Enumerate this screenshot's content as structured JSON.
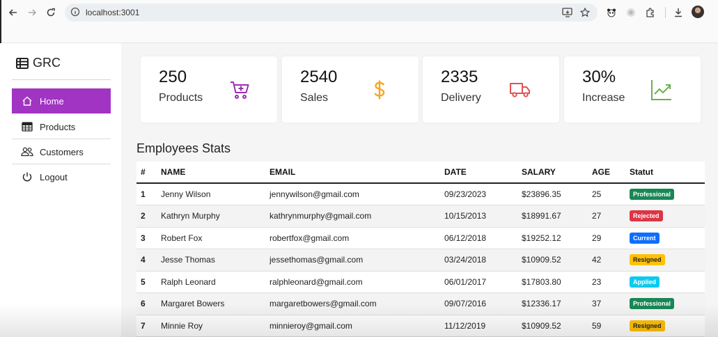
{
  "browser": {
    "url": "localhost:3001"
  },
  "sidebar": {
    "brand": "GRC",
    "items": [
      {
        "label": "Home",
        "icon": "home-icon",
        "active": true
      },
      {
        "label": "Products",
        "icon": "table-icon",
        "active": false
      },
      {
        "label": "Customers",
        "icon": "people-icon",
        "active": false
      },
      {
        "label": "Logout",
        "icon": "power-icon",
        "active": false
      }
    ]
  },
  "cards": [
    {
      "value": "250",
      "label": "Products",
      "icon": "cart-plus-icon",
      "color": "#9b2fae"
    },
    {
      "value": "2540",
      "label": "Sales",
      "icon": "dollar-icon",
      "color": "#f5a623"
    },
    {
      "value": "2335",
      "label": "Delivery",
      "icon": "truck-icon",
      "color": "#e05252"
    },
    {
      "value": "30%",
      "label": "Increase",
      "icon": "graph-up-icon",
      "color": "#6ab04c"
    }
  ],
  "employees": {
    "title": "Employees Stats",
    "columns": [
      "#",
      "NAME",
      "EMAIL",
      "DATE",
      "SALARY",
      "AGE",
      "Statut"
    ],
    "rows": [
      {
        "id": "1",
        "name": "Jenny Wilson",
        "email": "jennywilson@gmail.com",
        "date": "09/23/2023",
        "salary": "$23896.35",
        "age": "25",
        "status": "Professional"
      },
      {
        "id": "2",
        "name": "Kathryn Murphy",
        "email": "kathrynmurphy@gmail.com",
        "date": "10/15/2013",
        "salary": "$18991.67",
        "age": "27",
        "status": "Rejected"
      },
      {
        "id": "3",
        "name": "Robert Fox",
        "email": "robertfox@gmail.com",
        "date": "06/12/2018",
        "salary": "$19252.12",
        "age": "29",
        "status": "Current"
      },
      {
        "id": "4",
        "name": "Jesse Thomas",
        "email": "jessethomas@gmail.com",
        "date": "03/24/2018",
        "salary": "$10909.52",
        "age": "42",
        "status": "Resigned"
      },
      {
        "id": "5",
        "name": "Ralph Leonard",
        "email": "ralphleonard@gmail.com",
        "date": "06/01/2017",
        "salary": "$17803.80",
        "age": "23",
        "status": "Applied"
      },
      {
        "id": "6",
        "name": "Margaret Bowers",
        "email": "margaretbowers@gmail.com",
        "date": "09/07/2016",
        "salary": "$12336.17",
        "age": "37",
        "status": "Professional"
      },
      {
        "id": "7",
        "name": "Minnie Roy",
        "email": "minnieroy@gmail.com",
        "date": "11/12/2019",
        "salary": "$10909.52",
        "age": "59",
        "status": "Resigned"
      }
    ],
    "status_colors": {
      "Professional": {
        "bg": "#198754",
        "fg": "#ffffff"
      },
      "Rejected": {
        "bg": "#dc3545",
        "fg": "#ffffff"
      },
      "Current": {
        "bg": "#0d6efd",
        "fg": "#ffffff"
      },
      "Resigned": {
        "bg": "#ffc107",
        "fg": "#222222"
      },
      "Applied": {
        "bg": "#0dcaf0",
        "fg": "#ffffff"
      }
    }
  }
}
